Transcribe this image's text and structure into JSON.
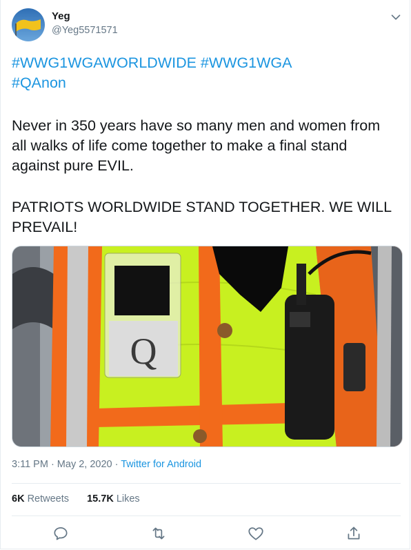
{
  "tweet": {
    "author": {
      "name": "Yeg",
      "handle": "@Yeg5571571"
    },
    "hashtags_line1": "#WWG1WGAWORLDWIDE #WWG1WGA",
    "hashtags_line2": "#QAnon",
    "para1_line1": "Never in 350 years have so many men and women from",
    "para1_line2": "all walks of life come together to make a final stand",
    "para1_line3": "against pure EVIL.",
    "para2_line1": "PATRIOTS WORLDWIDE STAND TOGETHER. WE WILL",
    "para2_line2": "PREVAIL!",
    "photo": {
      "badge_letter": "Q"
    },
    "timestamp": "3:11 PM · May 2, 2020 · ",
    "source": "Twitter for Android",
    "retweets_count": "6K",
    "retweets_label": " Retweets",
    "likes_count": "15.7K",
    "likes_label": " Likes"
  },
  "colors": {
    "link": "#1b95e0",
    "secondary_text": "#657786",
    "vest_yellow": "#c8f020",
    "vest_orange": "#f26a1b"
  },
  "icons": [
    "chevron-down-icon",
    "reply-icon",
    "retweet-icon",
    "like-icon",
    "share-icon"
  ]
}
